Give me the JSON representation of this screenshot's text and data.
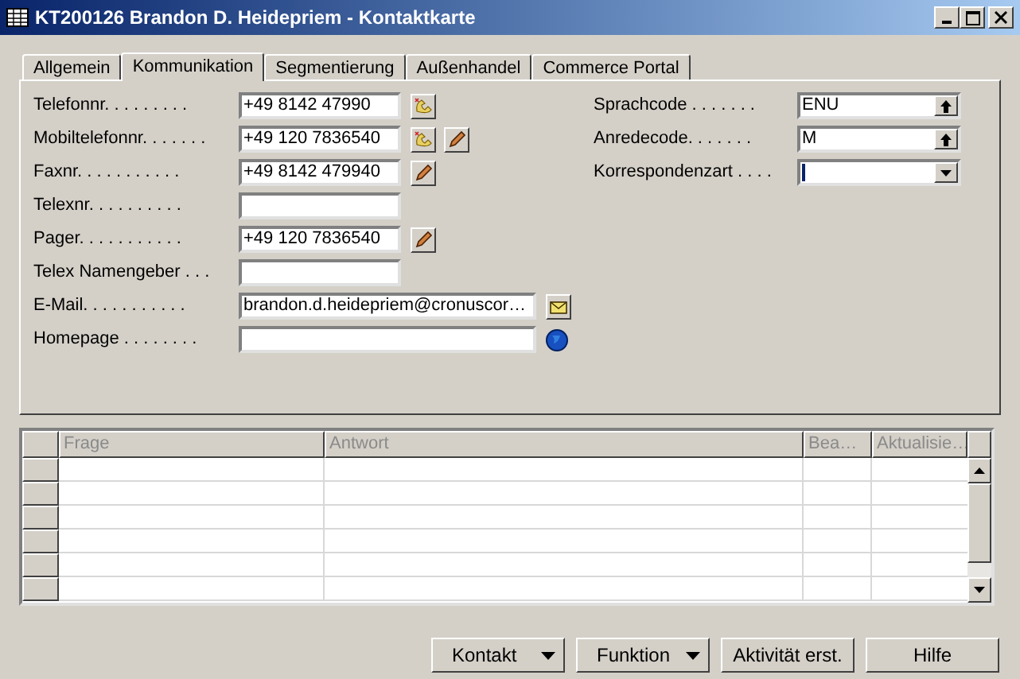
{
  "window": {
    "title": "KT200126 Brandon D. Heidepriem - Kontaktkarte"
  },
  "tabs": [
    {
      "label": "Allgemein",
      "selected": false
    },
    {
      "label": "Kommunikation",
      "selected": true
    },
    {
      "label": "Segmentierung",
      "selected": false
    },
    {
      "label": "Außenhandel",
      "selected": false
    },
    {
      "label": "Commerce Portal",
      "selected": false
    }
  ],
  "left_fields": [
    {
      "label": "Telefonnr. . . . . . . . .",
      "value": "+49 8142 47990",
      "wide": false,
      "actions": [
        {
          "kind": "phone"
        }
      ]
    },
    {
      "label": "Mobiltelefonnr. . . . . . .",
      "value": "+49 120 7836540",
      "wide": false,
      "actions": [
        {
          "kind": "phone"
        },
        {
          "kind": "pencil"
        }
      ]
    },
    {
      "label": "Faxnr. . . . . . . . . . .",
      "value": "+49 8142 479940",
      "wide": false,
      "actions": [
        {
          "kind": "pencil"
        }
      ]
    },
    {
      "label": "Telexnr. . . . . . . . . .",
      "wide": false
    },
    {
      "label": "Pager. . . . . . . . . . .",
      "value": "+49 120 7836540",
      "wide": false,
      "actions": [
        {
          "kind": "pencil"
        }
      ]
    },
    {
      "label": "Telex Namengeber . . .",
      "wide": false
    },
    {
      "label": "E-Mail. . . . . . . . . . .",
      "value": "brandon.d.heidepriem@cronuscor…",
      "wide": true,
      "actions": [
        {
          "kind": "mail"
        }
      ]
    },
    {
      "label": "Homepage . . . . . . . .",
      "wide": true,
      "actions": [
        {
          "kind": "globe"
        }
      ]
    }
  ],
  "right_fields": [
    {
      "label": "Sprachcode . . . . . . .",
      "value": "ENU",
      "kind": "lookup",
      "focused": false
    },
    {
      "label": "Anredecode. . . . . . .",
      "value": "M",
      "kind": "lookup",
      "focused": false
    },
    {
      "label": "Korrespondenzart . . . .",
      "kind": "dropdown",
      "focused": true
    }
  ],
  "table": {
    "columns": [
      "Frage",
      "Antwort",
      "Bea…",
      "Aktualisie…"
    ]
  },
  "buttons": [
    {
      "label": "Kontakt",
      "menu": true
    },
    {
      "label": "Funktion",
      "menu": true
    },
    {
      "label": "Aktivität erst.",
      "menu": false
    },
    {
      "label": "Hilfe",
      "menu": false
    }
  ]
}
